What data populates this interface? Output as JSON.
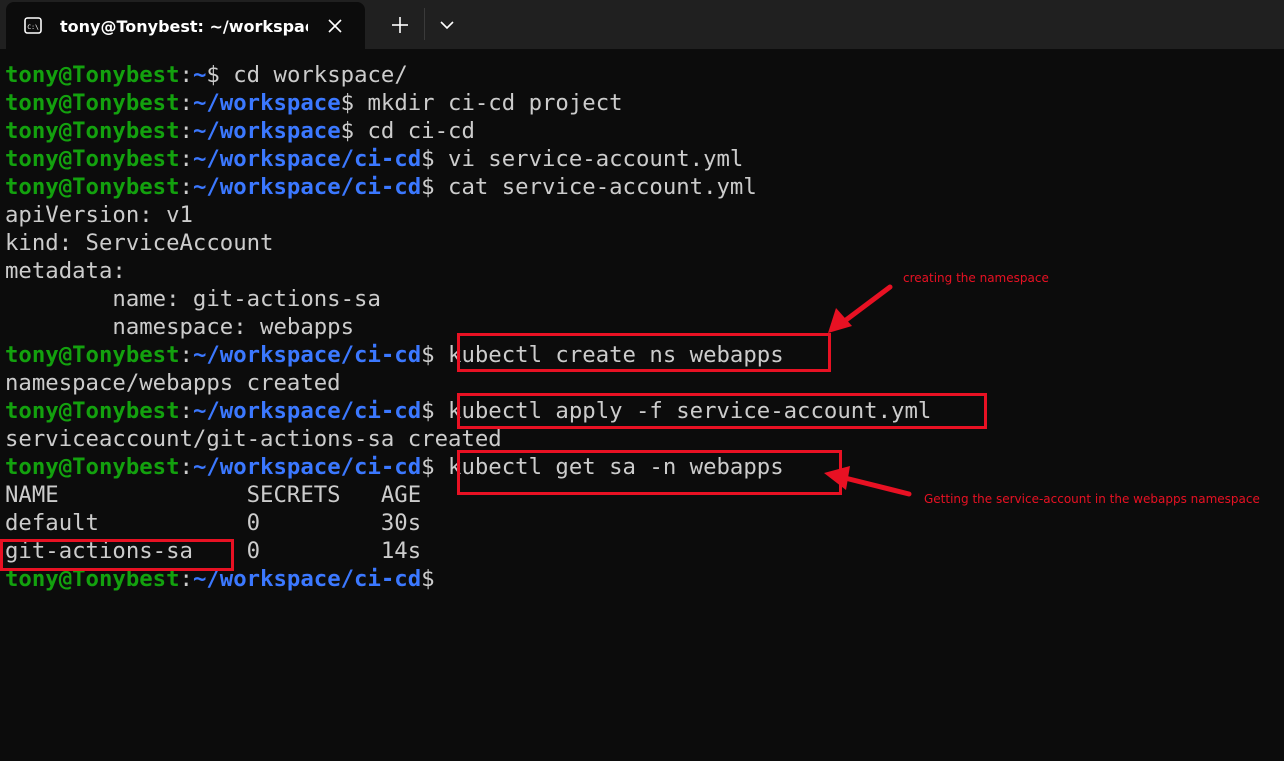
{
  "window": {
    "tab_title": "tony@Tonybest: ~/workspace"
  },
  "terminal": {
    "prompt_user": "tony@Tonybest",
    "lines": [
      {
        "path": "~",
        "cmd": " cd workspace/"
      },
      {
        "path": "~/workspace",
        "cmd": " mkdir ci-cd project"
      },
      {
        "path": "~/workspace",
        "cmd": " cd ci-cd"
      },
      {
        "path": "~/workspace/ci-cd",
        "cmd": " vi service-account.yml"
      },
      {
        "path": "~/workspace/ci-cd",
        "cmd": " cat service-account.yml"
      },
      {
        "out": "apiVersion: v1"
      },
      {
        "out": "kind: ServiceAccount"
      },
      {
        "out": "metadata:"
      },
      {
        "out": "        name: git-actions-sa"
      },
      {
        "out": "        namespace: webapps"
      },
      {
        "path": "~/workspace/ci-cd",
        "cmd": " kubectl create ns webapps"
      },
      {
        "out": "namespace/webapps created"
      },
      {
        "path": "~/workspace/ci-cd",
        "cmd": " kubectl apply -f service-account.yml"
      },
      {
        "out": "serviceaccount/git-actions-sa created"
      },
      {
        "path": "~/workspace/ci-cd",
        "cmd": " kubectl get sa -n webapps"
      },
      {
        "out": "NAME              SECRETS   AGE"
      },
      {
        "out": "default           0         30s"
      },
      {
        "out": "git-actions-sa    0         14s"
      },
      {
        "path": "~/workspace/ci-cd",
        "cmd": ""
      }
    ]
  },
  "annotations": {
    "note_namespace": "creating the namespace",
    "note_get_sa": "Getting the service-account in the webapps namespace"
  },
  "colors": {
    "background": "#0c0c0c",
    "titlebar": "#202020",
    "prompt_user": "#13a10e",
    "prompt_path": "#3b78ff",
    "text": "#cccccc",
    "annotation": "#e81123"
  }
}
